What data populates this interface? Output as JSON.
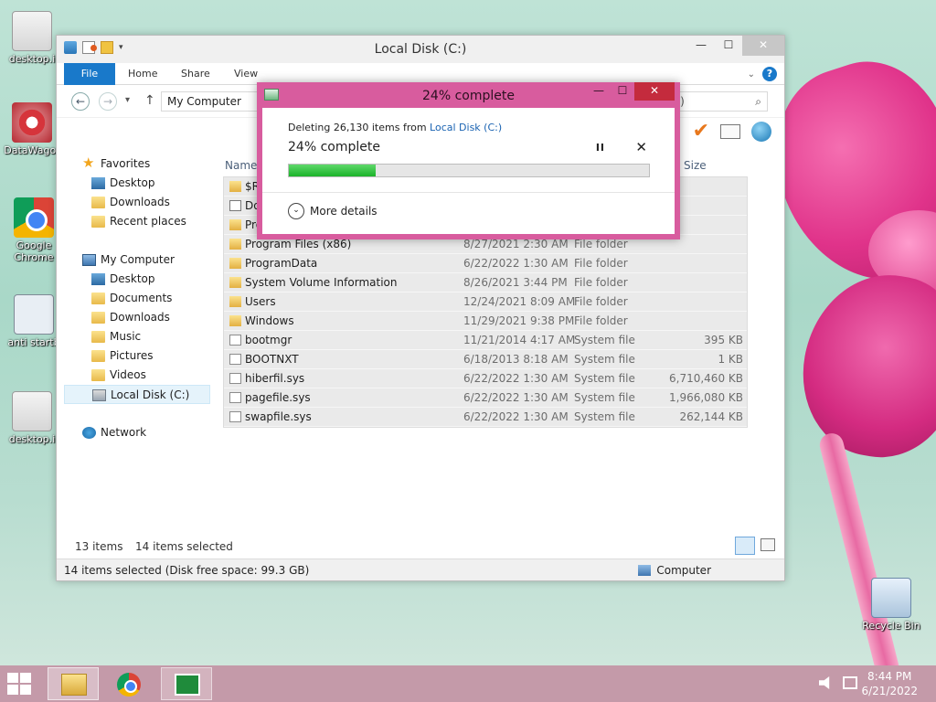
{
  "desktop": {
    "icons": [
      {
        "label": "desktop.i",
        "icon": "document-icon"
      },
      {
        "label": "DataWagor",
        "icon": "datawagon-icon"
      },
      {
        "label": "Google Chrome",
        "icon": "chrome-icon"
      },
      {
        "label": "anti startb",
        "icon": "settings-app-icon"
      },
      {
        "label": "desktop.i",
        "icon": "document-icon"
      },
      {
        "label": "Recycle Bin",
        "icon": "recycle-bin-icon"
      }
    ]
  },
  "explorer": {
    "title": "Local Disk (C:)",
    "qat_overflow": "▾",
    "controls": {
      "minimize": "—",
      "maximize": "☐",
      "close": "✕"
    },
    "ribbon": {
      "file": "File",
      "tabs": [
        "Home",
        "Share",
        "View"
      ],
      "expand": "⌄",
      "help": "?"
    },
    "nav": {
      "back": "←",
      "forward": "→",
      "recent": "▾",
      "up": "↑",
      "address_path": "My Computer",
      "search_partial": "(C:)",
      "search_icon": "⌕"
    },
    "navpane": {
      "favorites": "Favorites",
      "favorites_items": [
        "Desktop",
        "Downloads",
        "Recent places"
      ],
      "computer": "My Computer",
      "computer_items": [
        "Desktop",
        "Documents",
        "Downloads",
        "Music",
        "Pictures",
        "Videos",
        "Local Disk (C:)"
      ],
      "network": "Network"
    },
    "columns": {
      "name": "Name",
      "size": "Size"
    },
    "files": [
      {
        "name": "$R",
        "date": "",
        "type": "",
        "size": "",
        "icon": "folder"
      },
      {
        "name": "Do",
        "date": "",
        "type": "",
        "size": "",
        "icon": "link"
      },
      {
        "name": "Pro",
        "date": "",
        "type": "",
        "size": "",
        "icon": "folder"
      },
      {
        "name": "Program Files (x86)",
        "date": "8/27/2021 2:30 AM",
        "type": "File folder",
        "size": "",
        "icon": "folder"
      },
      {
        "name": "ProgramData",
        "date": "6/22/2022 1:30 AM",
        "type": "File folder",
        "size": "",
        "icon": "folder"
      },
      {
        "name": "System Volume Information",
        "date": "8/26/2021 3:44 PM",
        "type": "File folder",
        "size": "",
        "icon": "folder"
      },
      {
        "name": "Users",
        "date": "12/24/2021 8:09 AM",
        "type": "File folder",
        "size": "",
        "icon": "folder"
      },
      {
        "name": "Windows",
        "date": "11/29/2021 9:38 PM",
        "type": "File folder",
        "size": "",
        "icon": "folder"
      },
      {
        "name": "bootmgr",
        "date": "11/21/2014 4:17 AM",
        "type": "System file",
        "size": "395 KB",
        "icon": "sys"
      },
      {
        "name": "BOOTNXT",
        "date": "6/18/2013 8:18 AM",
        "type": "System file",
        "size": "1 KB",
        "icon": "sys"
      },
      {
        "name": "hiberfil.sys",
        "date": "6/22/2022 1:30 AM",
        "type": "System file",
        "size": "6,710,460 KB",
        "icon": "sys"
      },
      {
        "name": "pagefile.sys",
        "date": "6/22/2022 1:30 AM",
        "type": "System file",
        "size": "1,966,080 KB",
        "icon": "sys"
      },
      {
        "name": "swapfile.sys",
        "date": "6/22/2022 1:30 AM",
        "type": "System file",
        "size": "262,144 KB",
        "icon": "sys"
      }
    ],
    "bottom": {
      "count": "13 items",
      "selected": "14 items selected"
    },
    "status": {
      "text": "14 items selected (Disk free space: 99.3 GB)",
      "location": "Computer"
    }
  },
  "dialog": {
    "title": "24% complete",
    "controls": {
      "minimize": "—",
      "maximize": "☐",
      "close": "✕"
    },
    "line_prefix": "Deleting 26,130 items from ",
    "line_link": "Local Disk (C:)",
    "percent_label": "24% complete",
    "progress_fraction": 0.24,
    "pause": "II",
    "cancel": "✕",
    "more_details": "More details",
    "more_icon": "⌄"
  },
  "taskbar": {
    "apps": [
      "File Explorer",
      "Google Chrome",
      "Store"
    ],
    "time": "8:44 PM",
    "date": "6/21/2022"
  },
  "colors": {
    "accent": "#1979ca",
    "dialog_frame": "#d85c9e",
    "progress": "#1bb32a",
    "close": "#c42b3d"
  }
}
